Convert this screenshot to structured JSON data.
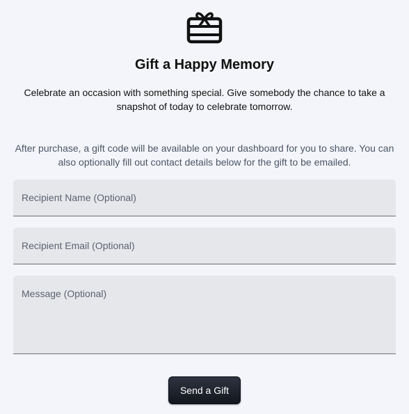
{
  "header": {
    "icon": "gift-card-icon",
    "title": "Gift a Happy Memory",
    "intro": "Celebrate an occasion with something special. Give somebody the chance to take a snapshot of today to celebrate tomorrow.",
    "note": "After purchase, a gift code will be available on your dashboard for you to share. You can also optionally fill out contact details below for the gift to be emailed."
  },
  "form": {
    "recipient_name": {
      "value": "",
      "placeholder": "Recipient Name (Optional)"
    },
    "recipient_email": {
      "value": "",
      "placeholder": "Recipient Email (Optional)"
    },
    "message": {
      "value": "",
      "placeholder": "Message (Optional)"
    },
    "submit_label": "Send a Gift"
  },
  "colors": {
    "background": "#f4f5fa",
    "field_background": "#e6e7eb",
    "button_background": "#1a1f29",
    "button_text": "#ffffff"
  }
}
